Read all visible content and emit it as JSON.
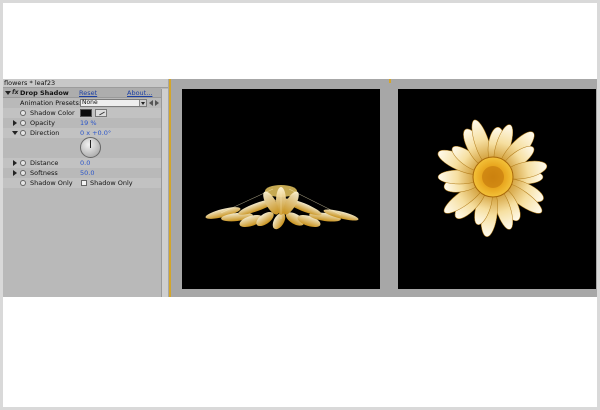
{
  "panel": {
    "tab_title": "flowers * leaf23",
    "effect": {
      "badge": "fx",
      "name": "Drop Shadow",
      "reset_label": "Reset",
      "about_label": "About...",
      "presets_label": "Animation Presets:",
      "presets_value": "None",
      "properties": {
        "shadow_color": {
          "label": "Shadow Color",
          "color": "#0c0c0c"
        },
        "opacity": {
          "label": "Opacity",
          "value": "19 %"
        },
        "direction": {
          "label": "Direction",
          "value": "0 x +0.0°"
        },
        "distance": {
          "label": "Distance",
          "value": "0.0"
        },
        "softness": {
          "label": "Softness",
          "value": "50.0"
        },
        "shadow_only": {
          "label": "Shadow Only",
          "checkbox_label": "Shadow Only",
          "checked": false
        }
      }
    }
  },
  "viewers": {
    "left": {
      "content": "daisy-petals-perspective"
    },
    "right": {
      "content": "daisy-front-view"
    }
  },
  "colors": {
    "panel_bg": "#b9b9b9",
    "viewer_bg": "#000000",
    "accent_separator": "#d4a62a",
    "value_blue": "#2a55c9"
  }
}
